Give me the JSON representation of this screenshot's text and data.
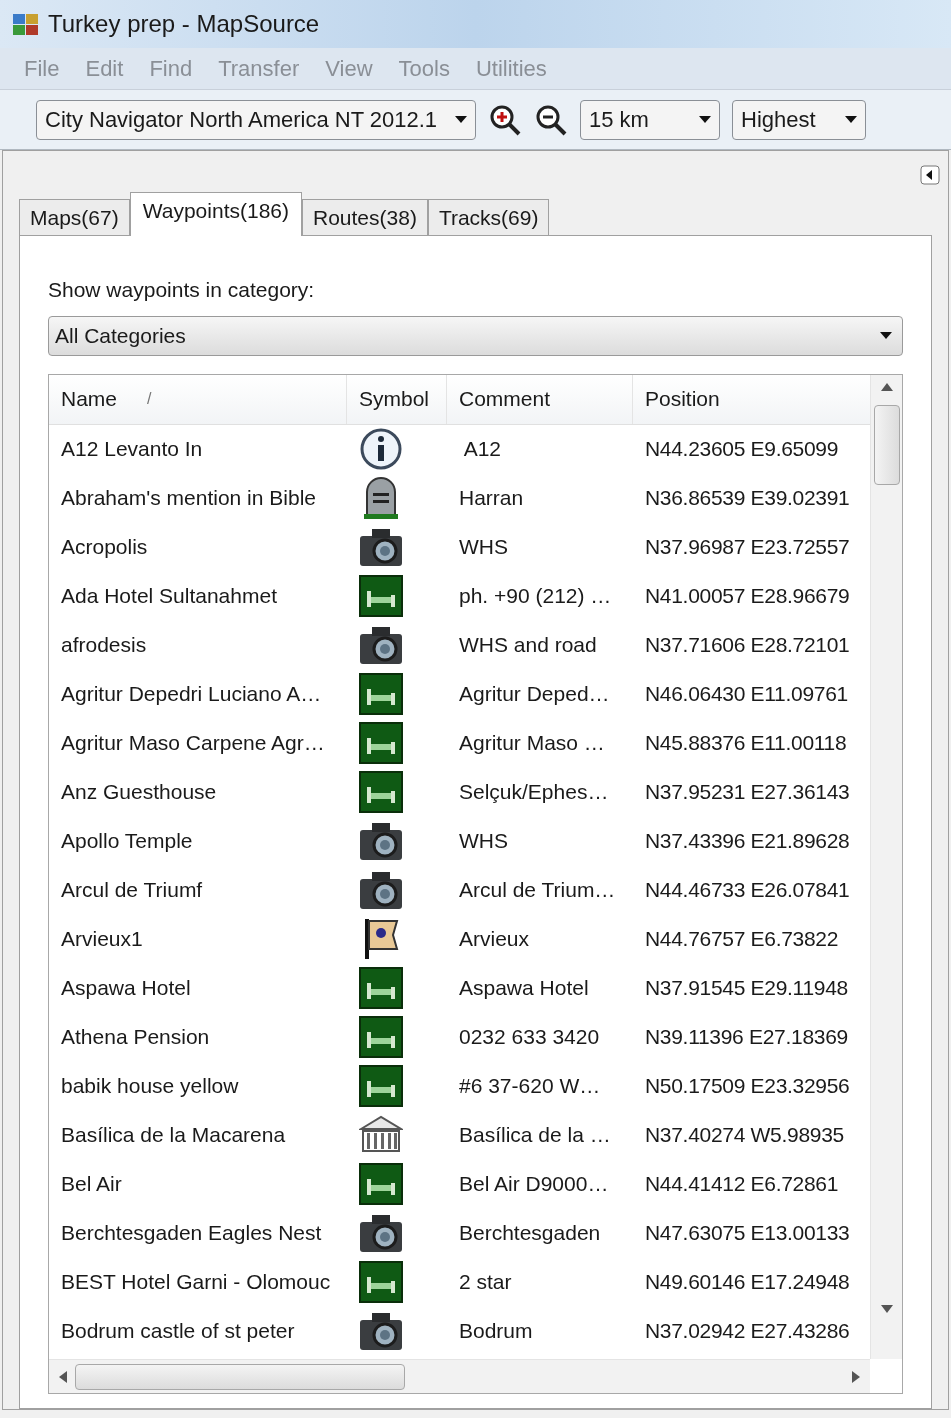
{
  "window": {
    "title": "Turkey prep - MapSource"
  },
  "menu": [
    "File",
    "Edit",
    "Find",
    "Transfer",
    "View",
    "Tools",
    "Utilities"
  ],
  "toolbar": {
    "map_product": "City Navigator North America NT 2012.1",
    "zoom_scale": "15 km",
    "detail": "Highest"
  },
  "tabs": [
    {
      "label": "Maps(67)",
      "selected": false
    },
    {
      "label": "Waypoints(186)",
      "selected": true
    },
    {
      "label": "Routes(38)",
      "selected": false
    },
    {
      "label": "Tracks(69)",
      "selected": false
    }
  ],
  "category": {
    "label": "Show waypoints in category:",
    "value": "All Categories"
  },
  "table": {
    "columns": [
      "Name",
      "Symbol",
      "Comment",
      "Position"
    ],
    "sort_mark": "/",
    "rows": [
      {
        "name": "A12 Levanto In",
        "kind": "info",
        "comment": " A12",
        "position": "N44.23605 E9.65099"
      },
      {
        "name": "Abraham's mention in Bible",
        "kind": "grave",
        "comment": "Harran",
        "position": "N36.86539 E39.02391"
      },
      {
        "name": "Acropolis",
        "kind": "camera",
        "comment": "WHS",
        "position": "N37.96987 E23.72557"
      },
      {
        "name": "Ada Hotel Sultanahmet",
        "kind": "lodging",
        "comment": "ph. +90 (212) …",
        "position": "N41.00057 E28.96679"
      },
      {
        "name": "afrodesis",
        "kind": "camera",
        "comment": "WHS and road",
        "position": "N37.71606 E28.72101"
      },
      {
        "name": "Agritur Depedri Luciano A…",
        "kind": "lodging",
        "comment": "Agritur Deped…",
        "position": "N46.06430 E11.09761"
      },
      {
        "name": "Agritur Maso Carpene Agr…",
        "kind": "lodging",
        "comment": "Agritur Maso …",
        "position": "N45.88376 E11.00118"
      },
      {
        "name": "Anz Guesthouse",
        "kind": "lodging",
        "comment": "Selçuk/Ephes…",
        "position": "N37.95231 E27.36143"
      },
      {
        "name": "Apollo Temple",
        "kind": "camera",
        "comment": "WHS",
        "position": "N37.43396 E21.89628"
      },
      {
        "name": "Arcul de Triumf",
        "kind": "camera",
        "comment": "Arcul de Trium…",
        "position": "N44.46733 E26.07841"
      },
      {
        "name": "Arvieux1",
        "kind": "flag",
        "comment": "Arvieux",
        "position": "N44.76757 E6.73822"
      },
      {
        "name": "Aspawa Hotel",
        "kind": "lodging",
        "comment": "Aspawa Hotel",
        "position": "N37.91545 E29.11948"
      },
      {
        "name": "Athena Pension",
        "kind": "lodging",
        "comment": "0232 633 3420",
        "position": "N39.11396 E27.18369"
      },
      {
        "name": "babik house yellow",
        "kind": "lodging",
        "comment": "#6 37-620 W…",
        "position": "N50.17509 E23.32956"
      },
      {
        "name": "Basílica de la Macarena",
        "kind": "building",
        "comment": "Basílica de la …",
        "position": "N37.40274 W5.98935"
      },
      {
        "name": "Bel Air",
        "kind": "lodging",
        "comment": "Bel Air D9000…",
        "position": "N44.41412 E6.72861"
      },
      {
        "name": "Berchtesgaden Eagles Nest",
        "kind": "camera",
        "comment": "Berchtesgaden",
        "position": "N47.63075 E13.00133"
      },
      {
        "name": "BEST Hotel Garni - Olomouc",
        "kind": "lodging",
        "comment": "2 star",
        "position": "N49.60146 E17.24948"
      },
      {
        "name": "Bodrum castle of st peter",
        "kind": "camera",
        "comment": "Bodrum",
        "position": "N37.02942 E27.43286"
      }
    ]
  }
}
